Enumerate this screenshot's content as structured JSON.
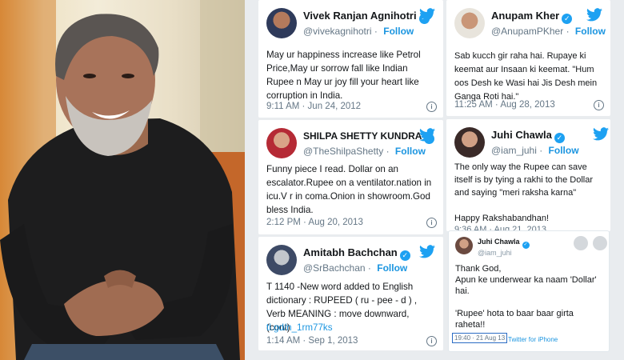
{
  "tweets": [
    {
      "name": "Vivek Ranjan Agnihotri",
      "handle": "@vivekagnihotri",
      "follow": "Follow",
      "text": "May ur happiness increase like Petrol Price,May ur sorrow fall like Indian Rupee n May ur joy fill your heart like corruption in India.",
      "time": "9:11 AM · Jun 24, 2012"
    },
    {
      "name": "Anupam Kher",
      "handle": "@AnupamPKher",
      "follow": "Follow",
      "text": "Sab kucch gir raha hai. Rupaye ki keemat aur Insaan ki keemat. \"Hum oos Desh ke Wasi hai Jis Desh mein Ganga Roti hai.\"",
      "time": "11:25 AM · Aug 28, 2013"
    },
    {
      "name": "SHILPA SHETTY KUNDRA",
      "handle": "@TheShilpaShetty",
      "follow": "Follow",
      "text": "Funny piece I read. Dollar on an escalator.Rupee on a ventilator.nation in icu.V r in coma.Onion in showroom.God bless India.",
      "time": "2:12 PM · Aug 20, 2013"
    },
    {
      "name": "Juhi Chawla",
      "handle": "@iam_juhi",
      "follow": "Follow",
      "text": "The only way the Rupee can save itself is by tying a rakhi to the Dollar and saying \"meri raksha karna\"\n\nHappy Rakshabandhan!",
      "time": "9:36 AM · Aug 21, 2013"
    },
    {
      "name": "Amitabh Bachchan",
      "handle": "@SrBachchan",
      "follow": "Follow",
      "text": "T 1140 -New word added to English dictionary : RUPEED ( ru - pee - d ) , Verb MEANING : move downward, (cont)",
      "link": "tl.gd/n_1rm77ks",
      "time": "1:14 AM · Sep 1, 2013"
    }
  ],
  "embedded": {
    "name": "Juhi Chawla",
    "handle": "@iam_juhi",
    "text": "Thank God,\nApun ke underwear ka naam 'Dollar' hai.\n\n'Rupee' hota to baar baar girta raheta!!",
    "time": "19:40 · 21 Aug 13",
    "source": "Twitter for iPhone"
  },
  "colors": {
    "twitter_blue": "#1da1f2",
    "follow_blue": "#1b95e0"
  }
}
